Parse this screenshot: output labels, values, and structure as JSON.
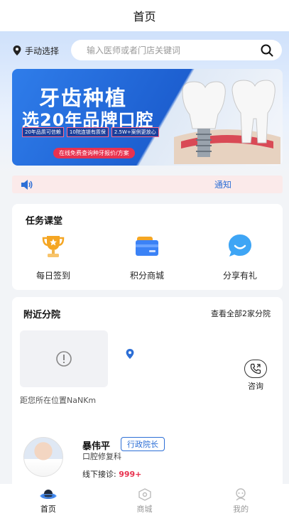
{
  "header": {
    "title": "首页"
  },
  "location": {
    "label": "手动选择"
  },
  "search": {
    "placeholder": "输入医师或者门店关键词"
  },
  "banner": {
    "headline": "牙齿种植",
    "subheadline": "选20年品牌口腔",
    "tags": [
      "20年品质可信赖",
      "10院连锁有质保",
      "2.5W+案例更放心"
    ],
    "cta": "在线免费查询种牙报价/方案"
  },
  "notice": {
    "text": "通知"
  },
  "tasks": {
    "title": "任务课堂",
    "items": [
      {
        "label": "每日签到",
        "icon": "trophy-icon"
      },
      {
        "label": "积分商城",
        "icon": "card-icon"
      },
      {
        "label": "分享有礼",
        "icon": "chat-bubble-icon"
      }
    ]
  },
  "branches": {
    "title": "附近分院",
    "view_all": "查看全部2家分院",
    "distance": "距您所在位置NaNKm",
    "consult_label": "咨询"
  },
  "doctor": {
    "name": "暴伟平",
    "title": "行政院长",
    "department": "口腔修复科",
    "offline_label": "线下接诊:",
    "offline_count": "999+"
  },
  "tabbar": {
    "items": [
      {
        "label": "首页",
        "active": true
      },
      {
        "label": "商城",
        "active": false
      },
      {
        "label": "我的",
        "active": false
      }
    ]
  },
  "colors": {
    "accent": "#2d6fd6",
    "highlight": "#e8324f",
    "notice_bg": "#fbeaea"
  }
}
